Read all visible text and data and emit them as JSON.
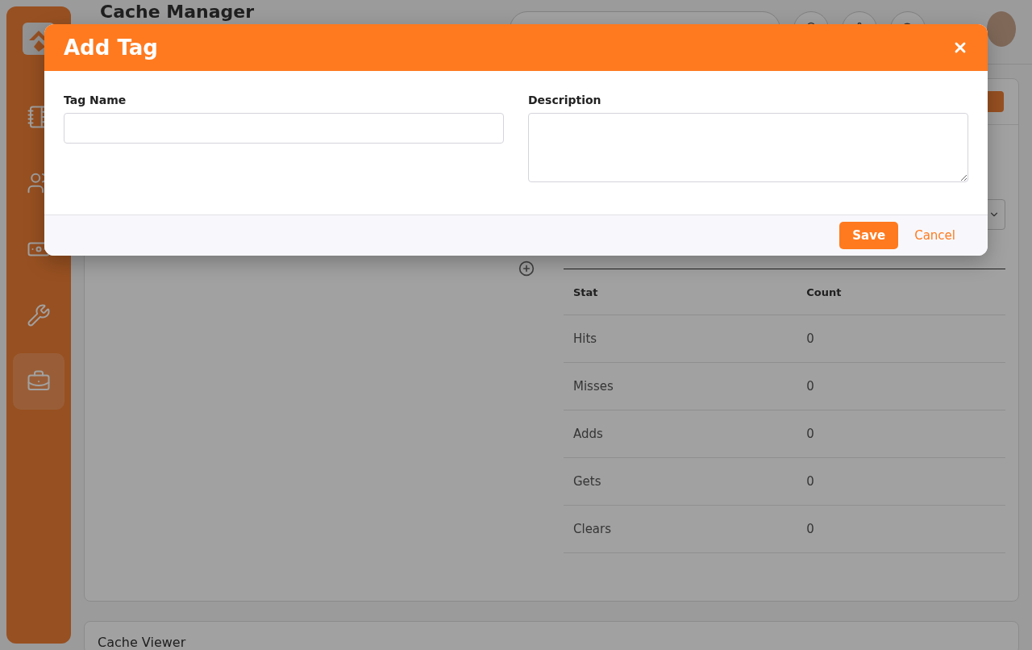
{
  "page": {
    "title": "Cache Manager"
  },
  "sidebar": {
    "items": [
      {
        "selected": false
      },
      {
        "selected": false
      },
      {
        "selected": false
      },
      {
        "selected": false
      },
      {
        "selected": true
      }
    ]
  },
  "stats_card": {
    "table": {
      "columns": [
        "Stat",
        "Count"
      ],
      "rows": [
        [
          "Hits",
          "0"
        ],
        [
          "Misses",
          "0"
        ],
        [
          "Adds",
          "0"
        ],
        [
          "Gets",
          "0"
        ],
        [
          "Clears",
          "0"
        ]
      ]
    }
  },
  "viewer_card": {
    "title": "Cache Viewer"
  },
  "modal": {
    "title": "Add Tag",
    "fields": [
      {
        "label": "Tag Name",
        "kind": "input"
      },
      {
        "label": "Description",
        "kind": "textarea"
      }
    ],
    "save": "Save",
    "cancel": "Cancel"
  }
}
